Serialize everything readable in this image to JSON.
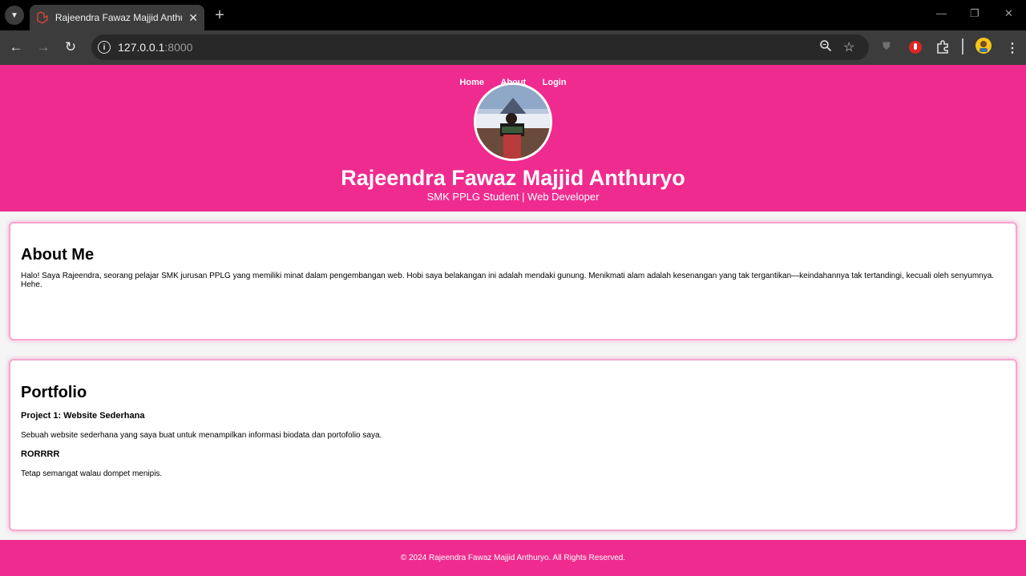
{
  "browser": {
    "tab_title": "Rajeendra Fawaz Majjid Anthuryo",
    "url_host": "127.0.0.1",
    "url_port": ":8000"
  },
  "nav": {
    "home": "Home",
    "about": "About",
    "login": "Login"
  },
  "hero": {
    "name": "Rajeendra Fawaz Majjid Anthuryo",
    "subtitle": "SMK PPLG Student | Web Developer"
  },
  "about": {
    "title": "About Me",
    "text": "Halo! Saya Rajeendra, seorang pelajar SMK jurusan PPLG yang memiliki minat dalam pengembangan web. Hobi saya belakangan ini adalah mendaki gunung. Menikmati alam adalah kesenangan yang tak tergantikan—keindahannya tak tertandingi, kecuali oleh senyumnya. Hehe."
  },
  "portfolio": {
    "title": "Portfolio",
    "projects": [
      {
        "title": "Project 1: Website Sederhana",
        "desc": "Sebuah website sederhana yang saya buat untuk menampilkan informasi biodata dan portofolio saya."
      },
      {
        "title": "RORRRR",
        "desc": "Tetap semangat walau dompet menipis."
      }
    ]
  },
  "footer": {
    "text": "© 2024 Rajeendra Fawaz Majjid Anthuryo. All Rights Reserved."
  },
  "colors": {
    "brand_pink": "#f02b8f",
    "chrome_dark": "#3c3c3c"
  }
}
